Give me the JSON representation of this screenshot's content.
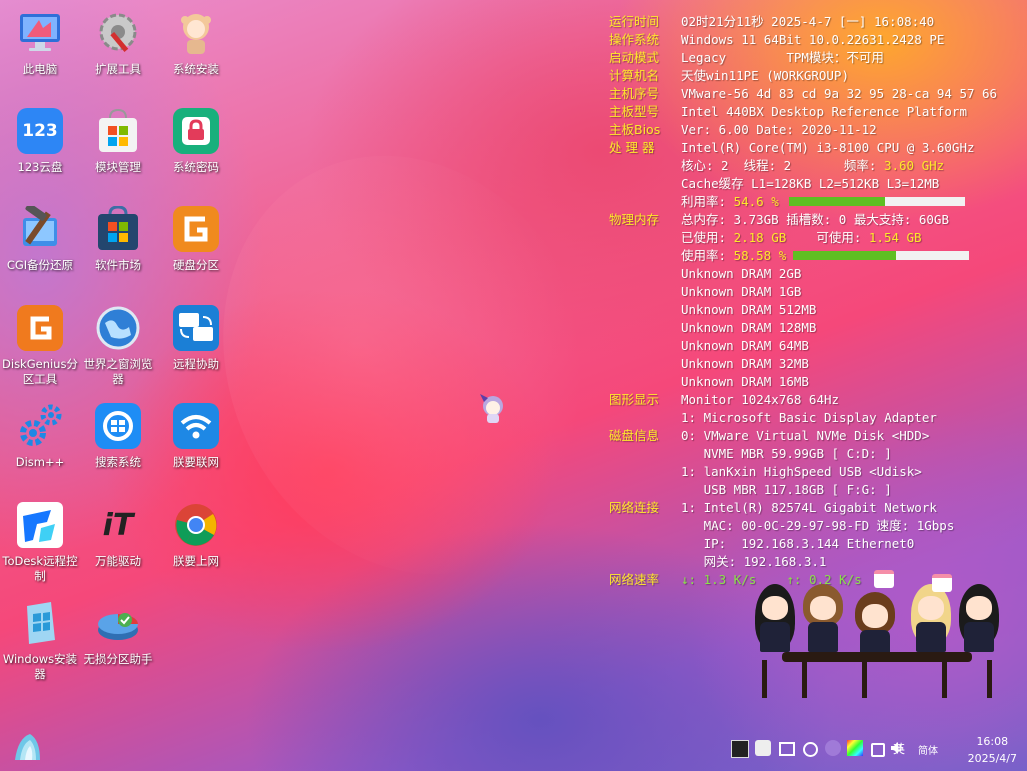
{
  "desktop_icons": [
    {
      "label": "此电脑"
    },
    {
      "label": "扩展工具"
    },
    {
      "label": "系统安装"
    },
    {
      "label": "123云盘"
    },
    {
      "label": "模块管理"
    },
    {
      "label": "系统密码"
    },
    {
      "label": "CGI备份还原"
    },
    {
      "label": "软件市场"
    },
    {
      "label": "硬盘分区"
    },
    {
      "label": "DiskGenius分区工具"
    },
    {
      "label": "世界之窗浏览器"
    },
    {
      "label": "远程协助"
    },
    {
      "label": "Dism++"
    },
    {
      "label": "搜索系统"
    },
    {
      "label": "朕要联网"
    },
    {
      "label": "ToDesk远程控制"
    },
    {
      "label": "万能驱动"
    },
    {
      "label": "朕要上网"
    },
    {
      "label": "Windows安装器"
    },
    {
      "label": "无损分区助手"
    }
  ],
  "icon_glyphs": {
    "cloud123": "123",
    "itdriver": "iT"
  },
  "sysinfo": {
    "uptime_label": "运行时间",
    "uptime_value": "02时21分11秒 2025-4-7 [一] 16:08:40",
    "os_label": "操作系统",
    "os_value": "Windows 11 64Bit 10.0.22631.2428 PE",
    "boot_label": "启动模式",
    "boot_value": "Legacy        TPM模块：不可用",
    "host_label": "计算机名",
    "host_value": "天使win11PE (WORKGROUP)",
    "serial_label": "主机序号",
    "serial_value": "VMware-56 4d 83 cd 9a 32 95 28-ca 94 57 66",
    "board_label": "主板型号",
    "board_value": "Intel 440BX Desktop Reference Platform",
    "bios_label": "主板Bios",
    "bios_value": "Ver: 6.00 Date: 2020-11-12",
    "cpu_label": "处 理 器",
    "cpu_value": "Intel(R) Core(TM) i3-8100 CPU @ 3.60GHz",
    "cores_text": "核心: 2  线程: 2       频率: ",
    "freq": "3.60 GHz",
    "cache": "Cache缓存 L1=128KB  L2=512KB  L3=12MB",
    "cpu_usage_label": "利用率: ",
    "cpu_usage": "54.6 %",
    "cpu_usage_fraction": 0.546,
    "mem_label": "物理内存",
    "mem_total": "总内存: 3.73GB  插槽数: 0  最大支持: 60GB",
    "mem_used_label": "已使用: ",
    "mem_used": "2.18 GB",
    "mem_avail_label": "    可使用: ",
    "mem_avail": "1.54 GB",
    "mem_usage_label": "使用率: ",
    "mem_usage": "58.58 %",
    "mem_usage_fraction": 0.5858,
    "dram": [
      "Unknown  DRAM 2GB",
      "Unknown  DRAM 1GB",
      "Unknown  DRAM 512MB",
      "Unknown  DRAM 128MB",
      "Unknown  DRAM 64MB",
      "Unknown  DRAM 32MB",
      "Unknown  DRAM 16MB"
    ],
    "gpu_label": "图形显示",
    "gpu_monitor": "Monitor 1024x768 64Hz",
    "gpu_adapter": "1: Microsoft Basic Display Adapter",
    "disk_label": "磁盘信息",
    "disk0": "0: VMware Virtual NVMe Disk <HDD>",
    "disk0_detail": "   NVME MBR 59.99GB [ C:D: ]",
    "disk1": "1: lanKxin HighSpeed USB <Udisk>",
    "disk1_detail": "   USB MBR 117.18GB [ F:G: ]",
    "net_label": "网络连接",
    "net_adapter": "1: Intel(R) 82574L Gigabit Network",
    "net_mac": "   MAC: 00-0C-29-97-98-FD 速度: 1Gbps",
    "net_ip": "   IP:  192.168.3.144 Ethernet0",
    "net_gw": "   网关: 192.168.3.1",
    "speed_label": "网络速率",
    "speed_down": "↓: 1.3 K/s",
    "speed_up": "↑: 0.2 K/s"
  },
  "taskbar": {
    "ime_mode": "英",
    "ime_variant": "简体",
    "time": "16:08",
    "date": "2025/4/7"
  },
  "colors": {
    "accent_yellow": "#ffe82b",
    "bar_green": "#5fbf22"
  }
}
